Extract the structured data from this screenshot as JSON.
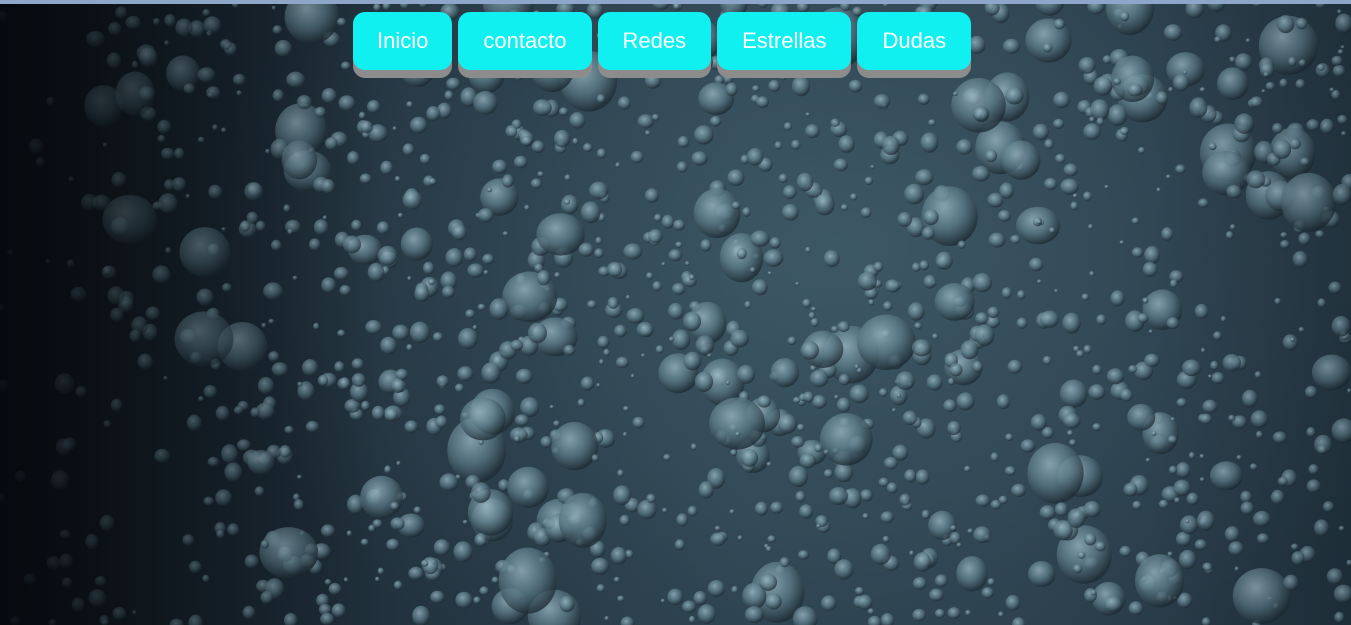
{
  "nav": {
    "items": [
      {
        "label": "Inicio"
      },
      {
        "label": "contacto"
      },
      {
        "label": "Redes"
      },
      {
        "label": "Estrellas"
      },
      {
        "label": "Dudas"
      }
    ]
  },
  "background": {
    "icon": "water-droplets-image"
  },
  "colors": {
    "button_bg": "#10f0f0",
    "button_shadow": "#8c8c8c",
    "button_text": "#ffffff",
    "top_strip": "#8ea7c9"
  }
}
